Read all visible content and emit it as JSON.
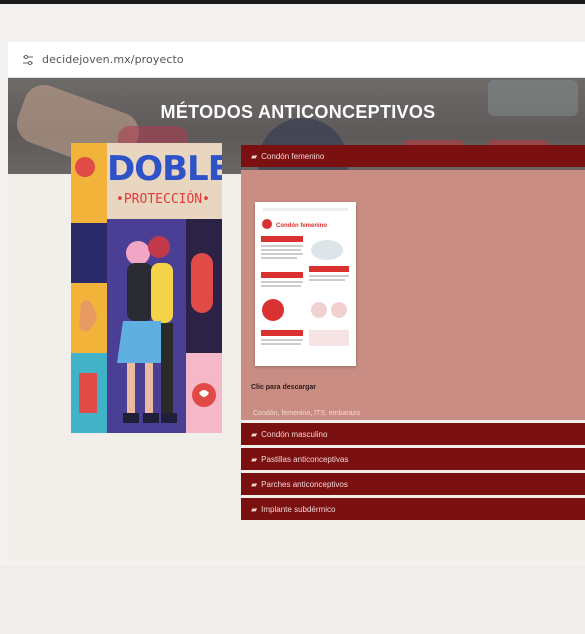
{
  "browser": {
    "url": "decidejoven.mx/proyecto"
  },
  "hero": {
    "title": "MÉTODOS ANTICONCEPTIVOS"
  },
  "poster": {
    "title": "DOBLE",
    "subtitle": "•PROTECCIÓN•"
  },
  "accordion": {
    "items": [
      {
        "label": "Condón femenino",
        "expanded": true
      },
      {
        "label": "Condón masculino",
        "expanded": false
      },
      {
        "label": "Pastillas anticonceptivas",
        "expanded": false
      },
      {
        "label": "Parches anticonceptivos",
        "expanded": false
      },
      {
        "label": "Implante subdérmico",
        "expanded": false
      }
    ],
    "panel": {
      "document_title": "Condón femenino",
      "download_label": "Clic para descargar",
      "tags": "Condón, femenino, ITS, embarazo"
    }
  },
  "colors": {
    "accordion_header": "#7b1010",
    "panel_bg": "#c98d83",
    "hero_bg": "#5d5a59"
  }
}
